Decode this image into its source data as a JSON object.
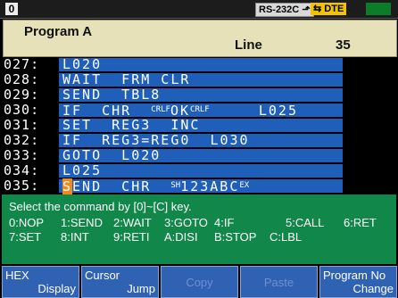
{
  "status": {
    "mode": "0",
    "rs232c_label": "RS-232C",
    "dte_label": "DTE",
    "colors": {
      "rs232c_bg": "#d9d9d9",
      "dte_bg": "#f2c400",
      "indicator": "#0b7d2a"
    }
  },
  "header": {
    "program": "Program A",
    "line_label": "Line",
    "line_number": "35"
  },
  "code": [
    {
      "line": "027:",
      "cmd": "L020"
    },
    {
      "line": "028:",
      "cmd": "WAIT  FRM CLR"
    },
    {
      "line": "029:",
      "cmd": "SEND  TBL8"
    },
    {
      "line": "030:",
      "cmd_a": "IF  CHR  ",
      "sub1": "CR",
      "sub2": "LF",
      "cmd_b": "OK",
      "sub3": "CR",
      "sub4": "LF",
      "cmd_c": "     L025"
    },
    {
      "line": "031:",
      "cmd": "SET  REG3  INC"
    },
    {
      "line": "032:",
      "cmd": "IF  REG3=REG0  L030"
    },
    {
      "line": "033:",
      "cmd": "GOTO  L020"
    },
    {
      "line": "034:",
      "cmd": "L025"
    },
    {
      "line": "035:",
      "cursor_char": "S",
      "cmd_rest": "END  CHR  ",
      "sub_sh": "SH",
      "cmd_mid": "123ABC",
      "sub_ex": "EX"
    }
  ],
  "help": {
    "prompt": "Select the command by [0]~[C] key.",
    "options_row1": [
      "0:NOP",
      "1:SEND",
      "2:WAIT",
      "3:GOTO",
      "4:IF",
      "5:CALL",
      "6:RET"
    ],
    "options_row2": [
      "7:SET",
      "8:INT",
      "9:RETI",
      "A:DISI",
      "B:STOP",
      "C:LBL"
    ]
  },
  "softkeys": [
    {
      "line1": "HEX",
      "line2": "Display",
      "enabled": true
    },
    {
      "line1": "Cursor",
      "line2": "Jump",
      "enabled": true
    },
    {
      "label": "Copy",
      "enabled": false
    },
    {
      "label": "Paste",
      "enabled": false
    },
    {
      "line1": "Program No",
      "line2": "Change",
      "enabled": true
    }
  ]
}
